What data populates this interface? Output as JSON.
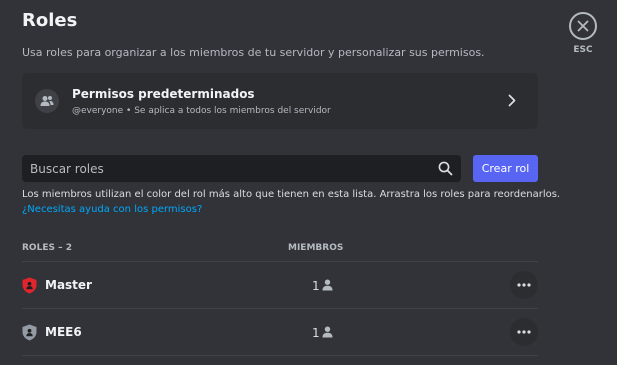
{
  "header": {
    "title": "Roles",
    "subtitle": "Usa roles para organizar a los miembros de tu servidor y personalizar sus permisos.",
    "esc_label": "ESC"
  },
  "default_permissions": {
    "title": "Permisos predeterminados",
    "subtitle": "@everyone • Se aplica a todos los miembros del servidor"
  },
  "search": {
    "placeholder": "Buscar roles",
    "value": ""
  },
  "create_button_label": "Crear rol",
  "info": {
    "text": "Los miembros utilizan el color del rol más alto que tienen en esta lista. Arrastra los roles para reordenarlos.",
    "help_link": "¿Necesitas ayuda con los permisos?"
  },
  "table": {
    "roles_header": "ROLES – 2",
    "members_header": "MIEMBROS",
    "rows": [
      {
        "name": "Master",
        "members": "1",
        "icon": "shield-icon",
        "color": "#e0262c"
      },
      {
        "name": "MEE6",
        "members": "1",
        "icon": "shield-icon",
        "color": "#949ba4"
      }
    ]
  },
  "colors": {
    "background": "#313338",
    "card": "#2b2d31",
    "input": "#1e1f22",
    "accent": "#5865f2",
    "link": "#00a8fc"
  }
}
